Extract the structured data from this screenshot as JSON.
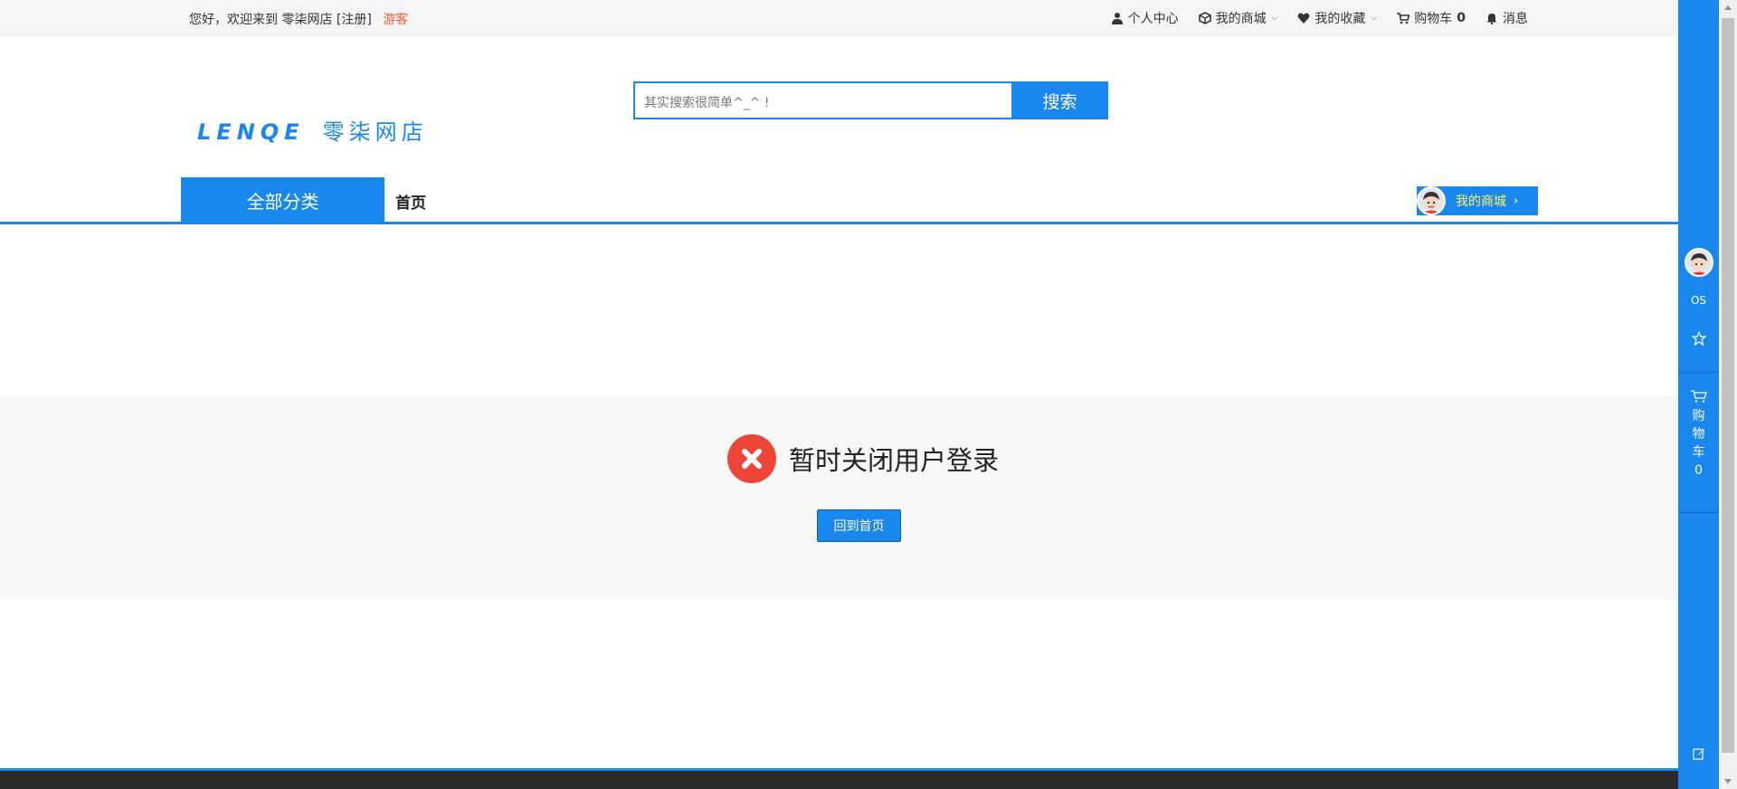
{
  "topbar": {
    "welcome": "您好，欢迎来到 零柒网店 [注册]",
    "guest": "游客",
    "links": {
      "profile": "个人中心",
      "my_mall": "我的商城",
      "favorites": "我的收藏",
      "cart_label": "购物车",
      "cart_count": "0",
      "messages": "消息"
    }
  },
  "header": {
    "logo_en": "LENQE",
    "logo_cn": "零柒网店",
    "search": {
      "placeholder": "其实搜索很简单^_^ !",
      "button": "搜索"
    }
  },
  "nav": {
    "all_categories": "全部分类",
    "home": "首页",
    "my_mall": "我的商城"
  },
  "error": {
    "message": "暂时关闭用户登录",
    "back_button": "回到首页"
  },
  "sidebar": {
    "os_label": "OS",
    "cart_chars": [
      "购",
      "物",
      "车"
    ],
    "cart_count": "0"
  },
  "colors": {
    "accent": "#1a87ee",
    "guest": "#f35b2c",
    "error": "#ef4438",
    "mall_text": "#fff35a"
  }
}
